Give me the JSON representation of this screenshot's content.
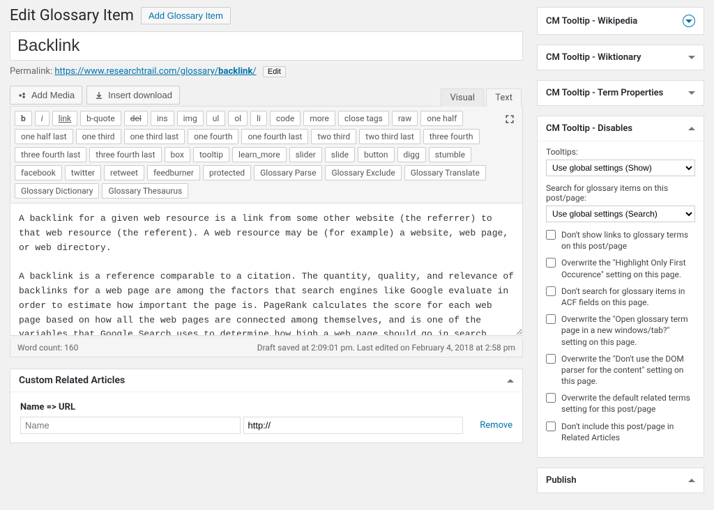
{
  "header": {
    "title": "Edit Glossary Item",
    "addButton": "Add Glossary Item"
  },
  "post": {
    "title": "Backlink",
    "permalinkLabel": "Permalink:",
    "permalinkBase": "https://www.researchtrail.com/glossary/",
    "permalinkSlug": "backlink",
    "editSlug": "Edit"
  },
  "media": {
    "add": "Add Media",
    "insert": "Insert download"
  },
  "editorTabs": {
    "visual": "Visual",
    "text": "Text"
  },
  "quicktags": [
    "b",
    "i",
    "link",
    "b-quote",
    "del",
    "ins",
    "img",
    "ul",
    "ol",
    "li",
    "code",
    "more",
    "close tags",
    "raw",
    "one half",
    "one half last",
    "one third",
    "one third last",
    "one fourth",
    "one fourth last",
    "two third",
    "two third last",
    "three fourth",
    "three fourth last",
    "three fourth last",
    "box",
    "tooltip",
    "learn_more",
    "slider",
    "slide",
    "button",
    "digg",
    "stumble",
    "facebook",
    "twitter",
    "retweet",
    "feedburner",
    "protected",
    "Glossary Parse",
    "Glossary Exclude",
    "Glossary Translate",
    "Glossary Dictionary",
    "Glossary Thesaurus"
  ],
  "content": "A backlink for a given web resource is a link from some other website (the referrer) to that web resource (the referent). A web resource may be (for example) a website, web page, or web directory.\n\nA backlink is a reference comparable to a citation. The quantity, quality, and relevance of backlinks for a web page are among the factors that search engines like Google evaluate in order to estimate how important the page is. PageRank calculates the score for each web page based on how all the web pages are connected among themselves, and is one of the variables that Google Search uses to determine how high a web page should go in search results. This weighting of backlinks is analogous to citation analysis of books, scholarly papers, and academic journals. A Topical PageRank has been researched and implemented as well, which gives more weight to backlinks coming from the page of a same topic as a target page.",
  "status": {
    "wordCount": "Word count: 160",
    "saved": "Draft saved at 2:09:01 pm. Last edited on February 4, 2018 at 2:58 pm"
  },
  "related": {
    "title": "Custom Related Articles",
    "headerLabel": "Name => URL",
    "namePlaceholder": "Name",
    "urlValue": "http://",
    "remove": "Remove"
  },
  "sideboxes": {
    "wikipedia": "CM Tooltip - Wikipedia",
    "wiktionary": "CM Tooltip - Wiktionary",
    "termProps": "CM Tooltip - Term Properties",
    "disables": "CM Tooltip - Disables",
    "publish": "Publish"
  },
  "disables": {
    "tooltipsLabel": "Tooltips:",
    "tooltipsSelect": "Use global settings (Show)",
    "searchLabel": "Search for glossary items on this post/page:",
    "searchSelect": "Use global settings (Search)",
    "checks": [
      "Don't show links to glossary terms on this post/page",
      "Overwrite the \"Highlight Only First Occurence\" setting on this page.",
      "Don't search for glossary items in ACF fields on this page.",
      "Overwrite the \"Open glossary term page in a new windows/tab?\" setting on this page.",
      "Overwrite the \"Don't use the DOM parser for the content\" setting on this page.",
      "Overwrite the default related terms setting for this post/page",
      "Don't include this post/page in Related Articles"
    ]
  }
}
